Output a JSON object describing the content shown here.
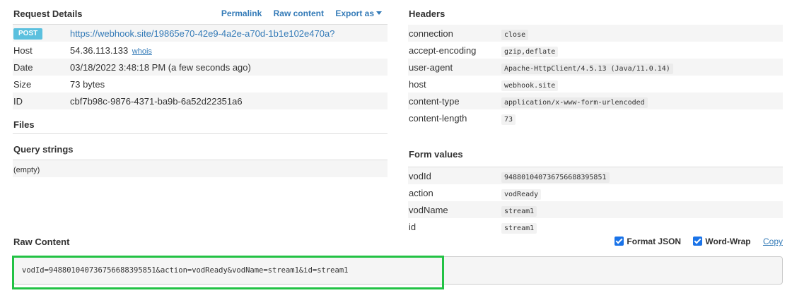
{
  "request_details": {
    "title": "Request Details",
    "links": {
      "permalink": "Permalink",
      "raw_content": "Raw content",
      "export_as": "Export as"
    },
    "method": "POST",
    "url": "https://webhook.site/19865e70-42e9-4a2e-a70d-1b1e102e470a?",
    "host_label": "Host",
    "host_value": "54.36.113.133",
    "whois": "whois",
    "date_label": "Date",
    "date_value": "03/18/2022 3:48:18 PM (a few seconds ago)",
    "size_label": "Size",
    "size_value": "73 bytes",
    "id_label": "ID",
    "id_value": "cbf7b98c-9876-4371-ba9b-6a52d22351a6"
  },
  "files": {
    "title": "Files"
  },
  "query_strings": {
    "title": "Query strings",
    "empty": "(empty)"
  },
  "headers": {
    "title": "Headers",
    "rows": [
      {
        "key": "connection",
        "value": "close"
      },
      {
        "key": "accept-encoding",
        "value": "gzip,deflate"
      },
      {
        "key": "user-agent",
        "value": "Apache-HttpClient/4.5.13 (Java/11.0.14)"
      },
      {
        "key": "host",
        "value": "webhook.site"
      },
      {
        "key": "content-type",
        "value": "application/x-www-form-urlencoded"
      },
      {
        "key": "content-length",
        "value": "73"
      }
    ]
  },
  "form_values": {
    "title": "Form values",
    "rows": [
      {
        "key": "vodId",
        "value": "948801040736756688395851"
      },
      {
        "key": "action",
        "value": "vodReady"
      },
      {
        "key": "vodName",
        "value": "stream1"
      },
      {
        "key": "id",
        "value": "stream1"
      }
    ]
  },
  "raw_content": {
    "title": "Raw Content",
    "format_json": "Format JSON",
    "word_wrap": "Word-Wrap",
    "copy": "Copy",
    "body": "vodId=948801040736756688395851&action=vodReady&vodName=stream1&id=stream1"
  },
  "colors": {
    "link": "#337ab7",
    "badge": "#5bc0de",
    "highlight": "#22c244",
    "checkbox": "#1a73e8"
  }
}
